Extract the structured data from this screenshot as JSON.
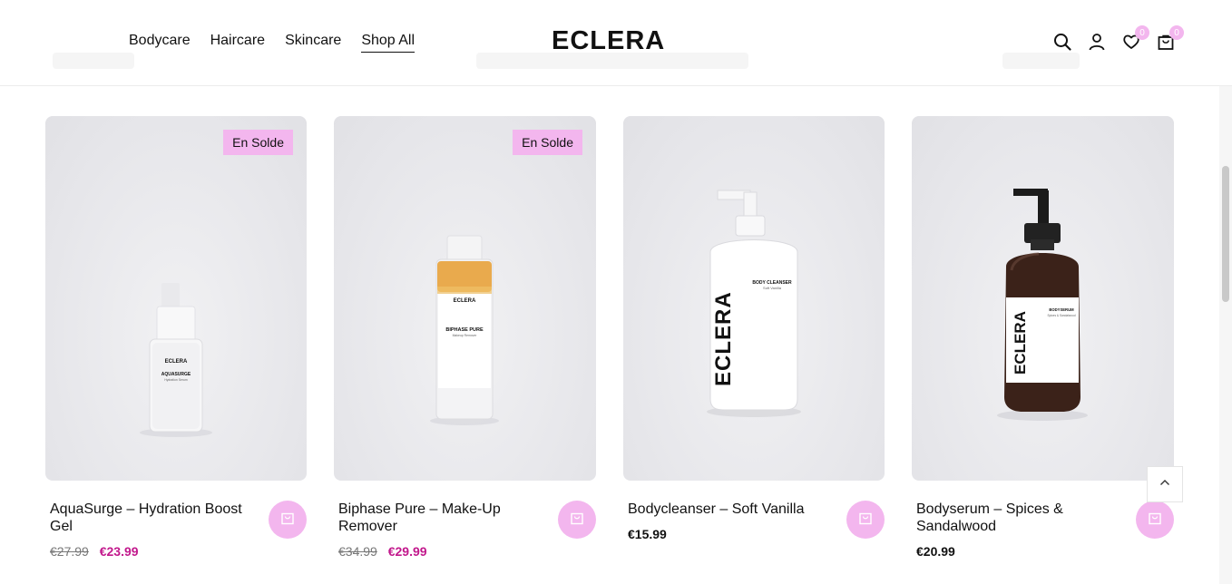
{
  "header": {
    "nav": [
      {
        "label": "Bodycare"
      },
      {
        "label": "Haircare"
      },
      {
        "label": "Skincare"
      },
      {
        "label": "Shop All",
        "active": true
      }
    ],
    "logo": "ECLERA",
    "icons": {
      "search": "search-icon",
      "account": "user-icon",
      "wishlist": "heart-icon",
      "cart": "cart-icon"
    },
    "wishlist_count": "0",
    "cart_count": "0"
  },
  "products": [
    {
      "name": "AquaSurge – Hydration Boost Gel",
      "badge": "En Solde",
      "old_price": "€27.99",
      "price": "€23.99",
      "bottle": {
        "brand": "ECLERA",
        "label": "AQUASURGE",
        "sub": "Hydration Serum"
      }
    },
    {
      "name": "Biphase Pure – Make-Up Remover",
      "badge": "En Solde",
      "old_price": "€34.99",
      "price": "€29.99",
      "bottle": {
        "brand": "ECLERA",
        "label": "BIPHASE PURE",
        "sub": "Makeup Remover"
      }
    },
    {
      "name": "Bodycleanser – Soft Vanilla",
      "price": "€15.99",
      "bottle": {
        "brand": "ECLERA",
        "label": "BODY CLEANSER",
        "sub": "Soft Vanilla"
      }
    },
    {
      "name": "Bodyserum – Spices & Sandalwood",
      "price": "€20.99",
      "bottle": {
        "brand": "ECLERA",
        "label": "BODYSERUM",
        "sub": "Spices & Sandalwood"
      }
    }
  ],
  "colors": {
    "accent_pink": "#f3b6ee",
    "sale_price": "#c2188c"
  },
  "back_to_top": "chevron-up-icon"
}
